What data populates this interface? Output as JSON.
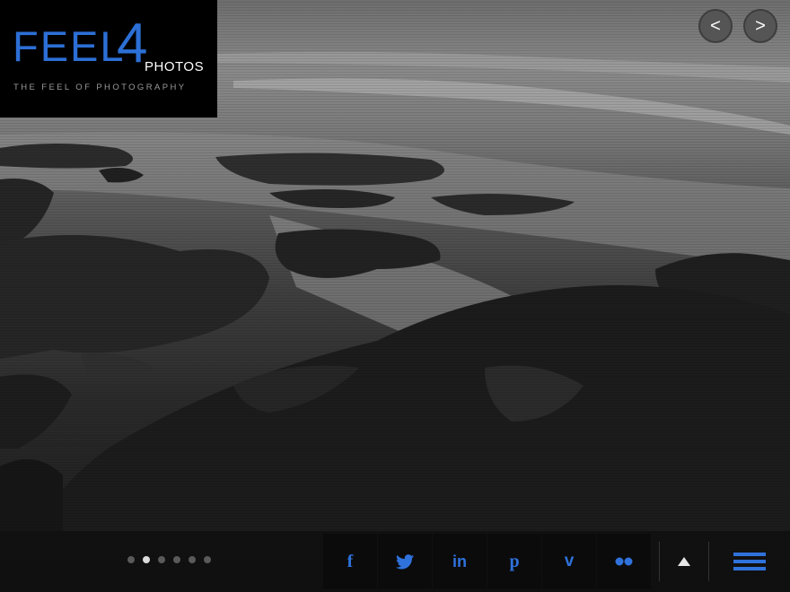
{
  "logo": {
    "word": "FEEL",
    "number": "4",
    "suffix": "PHOTOS",
    "tagline": "THE FEEL OF PHOTOGRAPHY"
  },
  "hero": {
    "image": "black-and-white rocky seashore",
    "prev_label": "<",
    "next_label": ">"
  },
  "slider": {
    "dots": 6,
    "active_index": 1
  },
  "social": [
    {
      "name": "facebook-icon",
      "glyph": "f"
    },
    {
      "name": "twitter-icon",
      "glyph": "🐦"
    },
    {
      "name": "linkedin-icon",
      "glyph": "in"
    },
    {
      "name": "pinterest-icon",
      "glyph": "p"
    },
    {
      "name": "vimeo-icon",
      "glyph": "v"
    },
    {
      "name": "flickr-icon",
      "glyph": "●●"
    }
  ],
  "colors": {
    "accent": "#2c6fd6",
    "bar": "#0c0c0c"
  },
  "icons": {
    "up": "triangle-up-icon",
    "menu": "hamburger-menu-icon"
  }
}
